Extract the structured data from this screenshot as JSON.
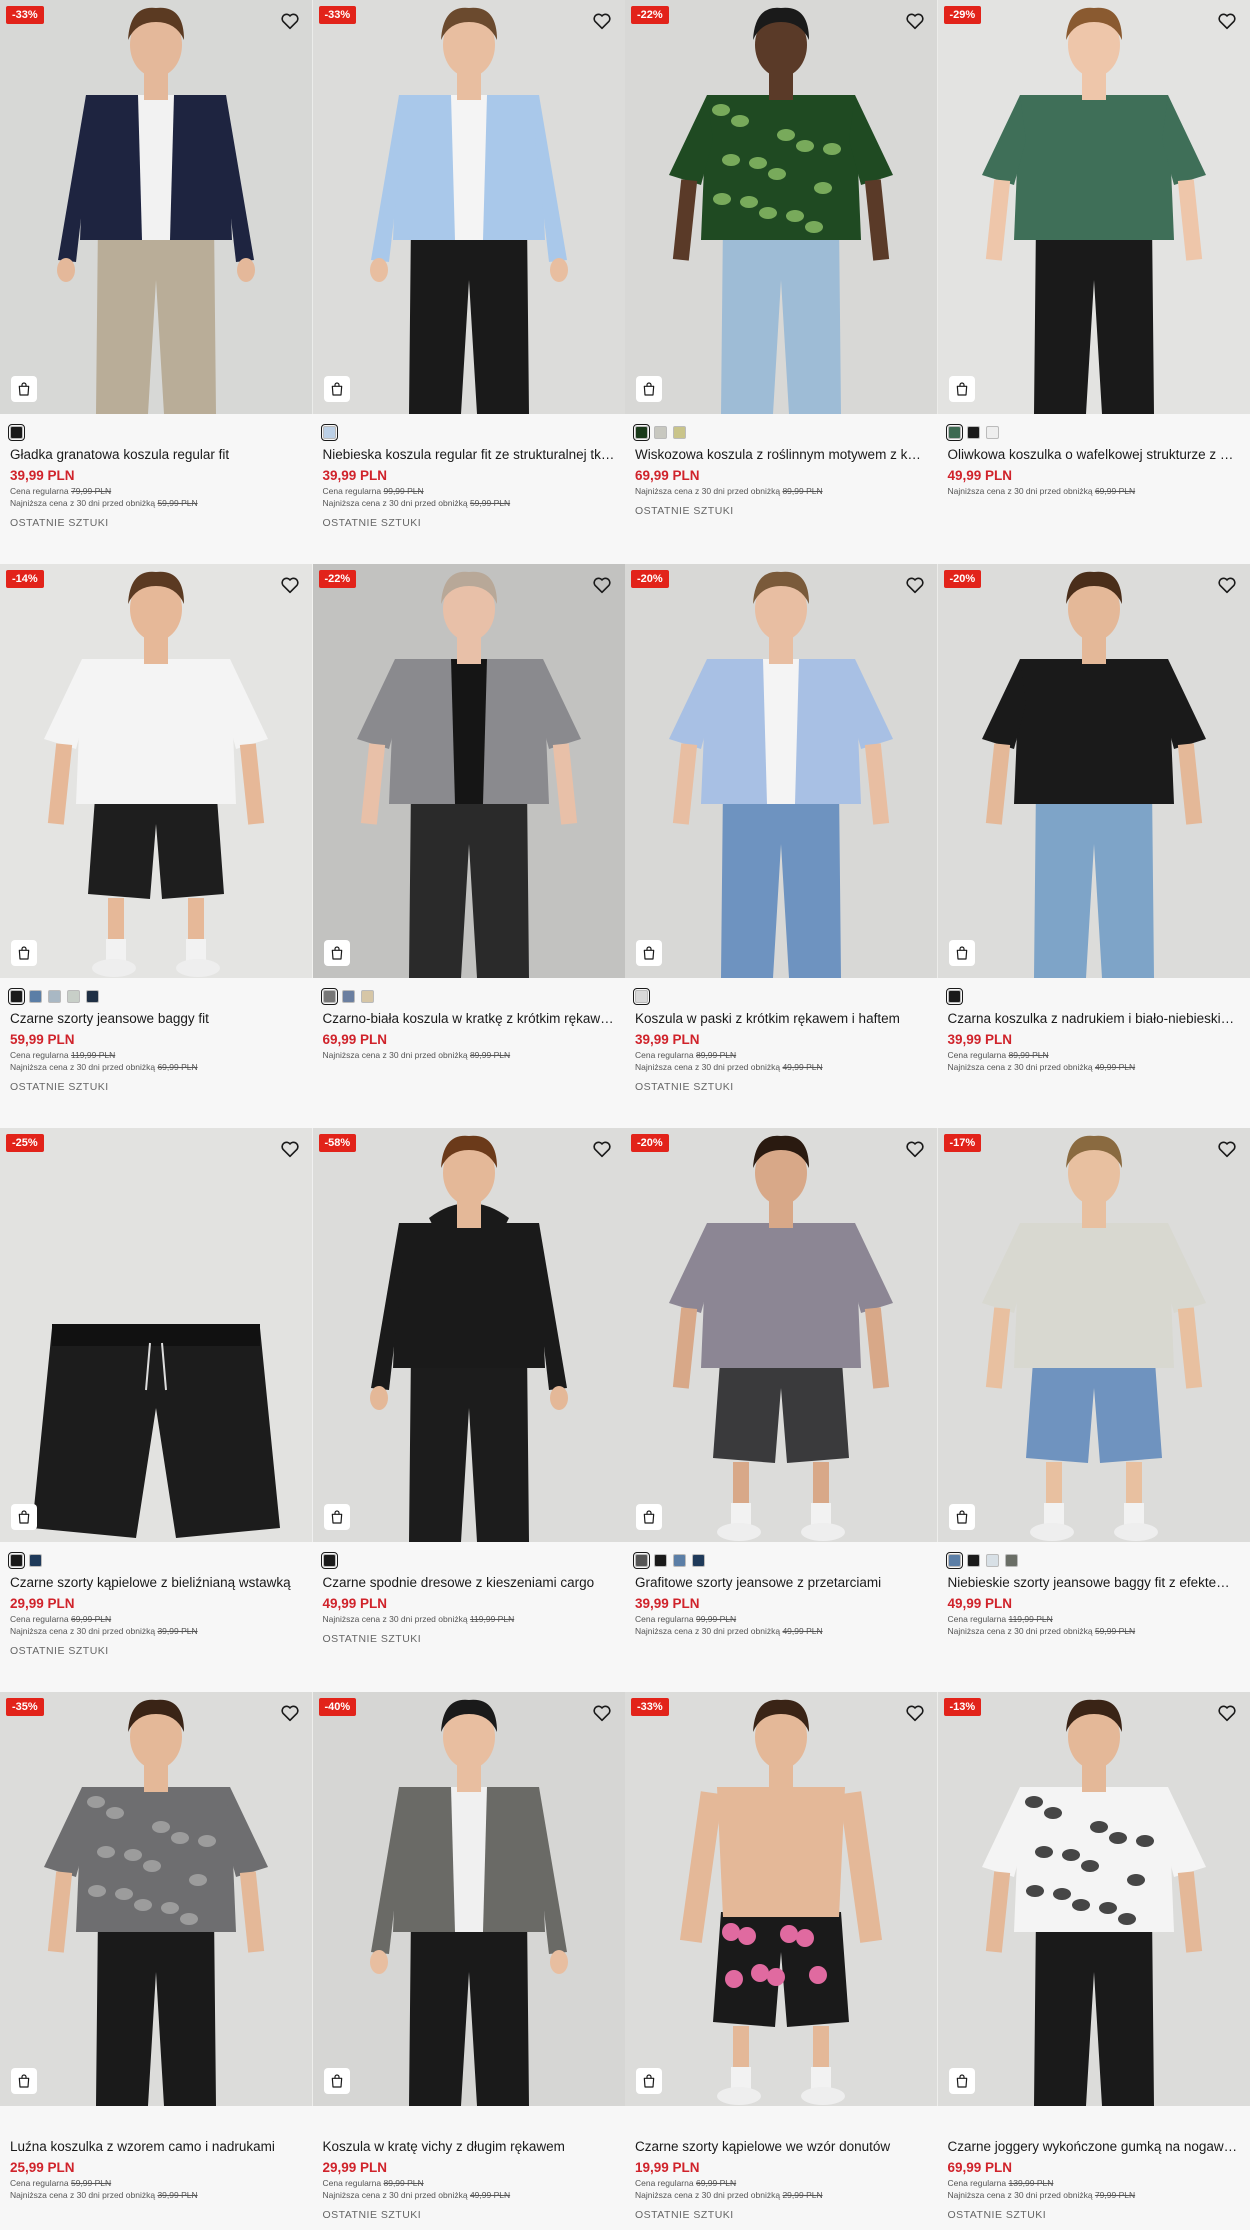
{
  "ui": {
    "regular_label": "Cena regularna",
    "lowest_label": "Najniższa cena z 30 dni przed obniżką",
    "last_items": "OSTATNIE SZTUKI"
  },
  "colors": {
    "accent_red": "#e2231a",
    "price_red": "#d0232b"
  },
  "icons": {
    "wishlist": "heart-icon",
    "cart": "shopping-bag-icon"
  },
  "products": [
    {
      "discount": "-33%",
      "name": "Gładka granatowa koszula regular fit",
      "price": "39,99 PLN",
      "regular": "79,99 PLN",
      "lowest": "59,99 PLN",
      "last": "OSTATNIE SZTUKI",
      "swatches": [
        "#1a1a1a"
      ],
      "bg": "#d7d8d6",
      "skin": "#e4b89a",
      "hair": "#5b3a22",
      "top": "#1e2440",
      "open": true,
      "inner": "#f2f2f2",
      "bottom": "#b9ad98",
      "long": true
    },
    {
      "discount": "-33%",
      "name": "Niebieska koszula regular fit ze strukturalnej tkaniny",
      "price": "39,99 PLN",
      "regular": "99,99 PLN",
      "lowest": "59,99 PLN",
      "last": "OSTATNIE SZTUKI",
      "swatches": [
        "#bcd0e6"
      ],
      "bg": "#dcdcda",
      "skin": "#e8bea0",
      "hair": "#6b4a2e",
      "top": "#a9c8ea",
      "open": true,
      "inner": "#f4f4f4",
      "bottom": "#1a1a1a",
      "long": true
    },
    {
      "discount": "-22%",
      "name": "Wiskozowa koszula z roślinnym motywem z kwiatami",
      "price": "69,99 PLN",
      "regular": null,
      "lowest": "89,99 PLN",
      "last": "OSTATNIE SZTUKI",
      "swatches": [
        "#1a3a1a",
        "#c8c8c0",
        "#c9c48a"
      ],
      "bg": "#d8d8d6",
      "skin": "#5a3a28",
      "hair": "#1a1a1a",
      "top": "#1f4a22",
      "pattern": "#8fc26a",
      "bottom": "#9ebcd6",
      "long": false
    },
    {
      "discount": "-29%",
      "name": "Oliwkowa koszulka o wafelkowej strukturze z naszywką",
      "price": "49,99 PLN",
      "regular": null,
      "lowest": "69,99 PLN",
      "last": null,
      "swatches": [
        "#3d6a52",
        "#1a1a1a",
        "#eeeeee"
      ],
      "bg": "#e3e3e1",
      "skin": "#eec6aa",
      "hair": "#8a5a30",
      "top": "#3f6f58",
      "bottom": "#1a1a1a",
      "long": false
    },
    {
      "discount": "-14%",
      "name": "Czarne szorty jeansowe baggy fit",
      "price": "59,99 PLN",
      "regular": "119,99 PLN",
      "lowest": "69,99 PLN",
      "last": "OSTATNIE SZTUKI",
      "swatches": [
        "#1a1a1a",
        "#5b7ea6",
        "#a9b8c4",
        "#c8cfc8",
        "#1f2f44"
      ],
      "bg": "#e4e4e2",
      "skin": "#e6b898",
      "hair": "#5b3a22",
      "top": "#f4f4f4",
      "bottom": "#1e1e1e",
      "long": false,
      "shorts": true
    },
    {
      "discount": "-22%",
      "name": "Czarno-biała koszula w kratkę z krótkim rękawem",
      "price": "69,99 PLN",
      "regular": null,
      "lowest": "89,99 PLN",
      "last": null,
      "swatches": [
        "#777777",
        "#6b7fa0",
        "#d6c6a6"
      ],
      "bg": "#c2c2c0",
      "skin": "#e8c0a8",
      "hair": "#b8a898",
      "top": "#8a8a8e",
      "open": true,
      "inner": "#151515",
      "bottom": "#2a2a2a",
      "long": false
    },
    {
      "discount": "-20%",
      "name": "Koszula w paski z krótkim rękawem i haftem",
      "price": "39,99 PLN",
      "regular": "89,99 PLN",
      "lowest": "49,99 PLN",
      "last": "OSTATNIE SZTUKI",
      "swatches": [
        "#d8d8d8"
      ],
      "bg": "#d8d8d6",
      "skin": "#e8bea2",
      "hair": "#7a5a3a",
      "top": "#a8c0e4",
      "open": true,
      "inner": "#f4f4f4",
      "bottom": "#6e93c0",
      "long": false
    },
    {
      "discount": "-20%",
      "name": "Czarna koszulka z nadrukiem i biało-niebieskimi wstawkami",
      "price": "39,99 PLN",
      "regular": "89,99 PLN",
      "lowest": "49,99 PLN",
      "last": null,
      "swatches": [
        "#1a1a1a"
      ],
      "bg": "#dcdcda",
      "skin": "#e4b898",
      "hair": "#4a2e1a",
      "top": "#1a1a1a",
      "bottom": "#7ea4c8",
      "long": false
    },
    {
      "discount": "-25%",
      "name": "Czarne szorty kąpielowe z bieliźnianą wstawką",
      "price": "29,99 PLN",
      "regular": "69,99 PLN",
      "lowest": "39,99 PLN",
      "last": "OSTATNIE SZTUKI",
      "swatches": [
        "#1a1a1a",
        "#1f3a5a"
      ],
      "bg": "#e2e2e0",
      "product_only": true,
      "bottom": "#1c1c1c"
    },
    {
      "discount": "-58%",
      "name": "Czarne spodnie dresowe z kieszeniami cargo",
      "price": "49,99 PLN",
      "regular": null,
      "lowest": "119,99 PLN",
      "last": "OSTATNIE SZTUKI",
      "swatches": [
        "#1a1a1a"
      ],
      "bg": "#dcdcda",
      "skin": "#e4b898",
      "hair": "#6b3a1a",
      "top": "#1a1a1a",
      "bottom": "#1c1c1c",
      "long": true,
      "hood": true
    },
    {
      "discount": "-20%",
      "name": "Grafitowe szorty jeansowe z przetarciami",
      "price": "39,99 PLN",
      "regular": "99,99 PLN",
      "lowest": "49,99 PLN",
      "last": null,
      "swatches": [
        "#555555",
        "#1a1a1a",
        "#5b7ea6",
        "#1f3a5a"
      ],
      "bg": "#dcdcda",
      "skin": "#d8a888",
      "hair": "#2a1a10",
      "top": "#8c8694",
      "bottom": "#3a3a3c",
      "long": false,
      "shorts": true
    },
    {
      "discount": "-17%",
      "name": "Niebieskie szorty jeansowe baggy fit z efektem sprania",
      "price": "49,99 PLN",
      "regular": "119,99 PLN",
      "lowest": "59,99 PLN",
      "last": null,
      "swatches": [
        "#5b7ea6",
        "#1a1a1a",
        "#d8e0e6",
        "#6a6e66"
      ],
      "bg": "#dcdcda",
      "skin": "#e8c0a0",
      "hair": "#8a6a40",
      "top": "#d8d8d0",
      "bottom": "#6f93bf",
      "long": false,
      "shorts": true
    },
    {
      "discount": "-35%",
      "name": "Luźna koszulka z wzorem camo i nadrukami",
      "price": "25,99 PLN",
      "regular": "59,99 PLN",
      "lowest": "39,99 PLN",
      "last": null,
      "swatches": [],
      "bg": "#dcdcda",
      "skin": "#e4b898",
      "hair": "#3a2416",
      "top": "#6e6e70",
      "pattern": "#a8a8a8",
      "bottom": "#1a1a1a",
      "long": false
    },
    {
      "discount": "-40%",
      "name": "Koszula w kratę vichy z długim rękawem",
      "price": "29,99 PLN",
      "regular": "89,99 PLN",
      "lowest": "49,99 PLN",
      "last": "OSTATNIE SZTUKI",
      "swatches": [],
      "bg": "#d6d6d4",
      "skin": "#e8bea0",
      "hair": "#1a1a1a",
      "top": "#6a6a66",
      "open": true,
      "inner": "#f0f0f0",
      "bottom": "#1a1a1a",
      "long": true
    },
    {
      "discount": "-33%",
      "name": "Czarne szorty kąpielowe we wzór donutów",
      "price": "19,99 PLN",
      "regular": "69,99 PLN",
      "lowest": "29,99 PLN",
      "last": "OSTATNIE SZTUKI",
      "swatches": [],
      "bg": "#dcdcda",
      "skin": "#e4b898",
      "hair": "#3a2416",
      "top": null,
      "pattern": "#e06aa0",
      "bottom": "#1a1a1a",
      "long": false,
      "shorts": true
    },
    {
      "discount": "-13%",
      "name": "Czarne joggery wykończone gumką na nogawkach",
      "price": "69,99 PLN",
      "regular": "139,99 PLN",
      "lowest": "79,99 PLN",
      "last": "OSTATNIE SZTUKI",
      "swatches": [],
      "bg": "#dcdcda",
      "skin": "#e4b898",
      "hair": "#3a2416",
      "top": "#f4f4f4",
      "pattern": "#1a1a1a",
      "bottom": "#1a1a1a",
      "long": false
    }
  ]
}
